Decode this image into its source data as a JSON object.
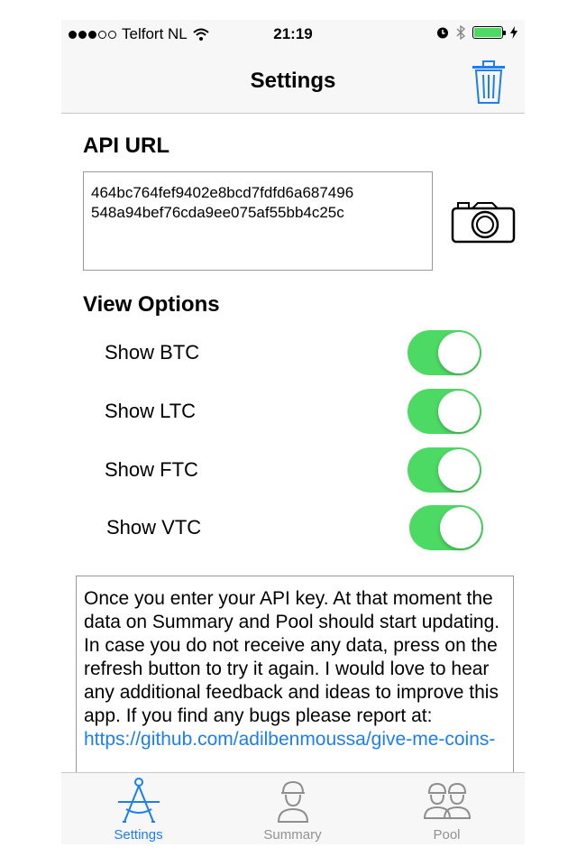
{
  "status_bar": {
    "carrier": "Telfort NL",
    "time": "21:19",
    "signal_bars_filled": 3,
    "signal_bars_total": 5,
    "battery_level": 1.0,
    "icons": [
      "wifi-icon",
      "alarm-icon",
      "bluetooth-icon",
      "battery-icon",
      "charging-icon"
    ]
  },
  "nav": {
    "title": "Settings",
    "right_button_icon": "trash-icon"
  },
  "api": {
    "section_title": "API URL",
    "value": "464bc764fef9402e8bcd7fdfd6a687496\n548a94bef76cda9ee075af55bb4c25c",
    "camera_icon": "camera-icon"
  },
  "view_options": {
    "section_title": "View Options",
    "items": [
      {
        "label": "Show BTC",
        "on": true
      },
      {
        "label": "Show LTC",
        "on": true
      },
      {
        "label": "Show FTC",
        "on": true
      },
      {
        "label": "Show VTC",
        "on": true
      }
    ]
  },
  "info": {
    "text": "Once you enter your API key. At that moment the data on Summary and Pool should start updating. In case you do not receive any data, press on the refresh button to try it again. I would love to hear any additional feedback and ideas to improve this app. If you find any bugs please report at: ",
    "link": "https://github.com/adilbenmoussa/give-me-coins-"
  },
  "tabs": [
    {
      "label": "Settings",
      "icon": "compass-icon",
      "active": true
    },
    {
      "label": "Summary",
      "icon": "miner-icon",
      "active": false
    },
    {
      "label": "Pool",
      "icon": "miners-group-icon",
      "active": false
    }
  ],
  "colors": {
    "accent": "#1d7ef0",
    "toggle_on": "#4cd964",
    "bar_background": "#f7f7f7"
  }
}
